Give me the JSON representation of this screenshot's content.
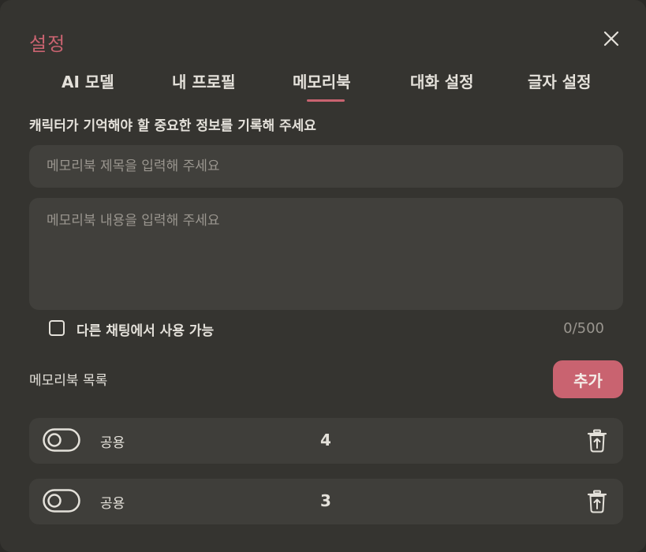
{
  "dialog": {
    "title": "설정",
    "close_icon": "close-icon"
  },
  "tabs": [
    {
      "label": "AI 모델",
      "active": false
    },
    {
      "label": "내 프로필",
      "active": false
    },
    {
      "label": "메모리북",
      "active": true
    },
    {
      "label": "대화 설정",
      "active": false
    },
    {
      "label": "글자 설정",
      "active": false
    }
  ],
  "memorybook": {
    "description": "캐릭터가 기억해야 할 중요한 정보를 기록해 주세요",
    "title_placeholder": "메모리북 제목을 입력해 주세요",
    "title_value": "",
    "content_placeholder": "메모리북 내용을 입력해 주세요",
    "content_value": "",
    "share_checkbox_label": "다른 채팅에서 사용 가능",
    "share_checked": false,
    "char_counter": "0/500",
    "list_heading": "메모리북 목록",
    "add_button": "추가",
    "items": [
      {
        "scope": "공용",
        "count": "4",
        "enabled": false
      },
      {
        "scope": "공용",
        "count": "3",
        "enabled": false
      }
    ]
  },
  "colors": {
    "accent": "#c96370",
    "background": "#353430",
    "field": "#41403c",
    "text": "#e4e1da",
    "muted": "#9a968f"
  }
}
